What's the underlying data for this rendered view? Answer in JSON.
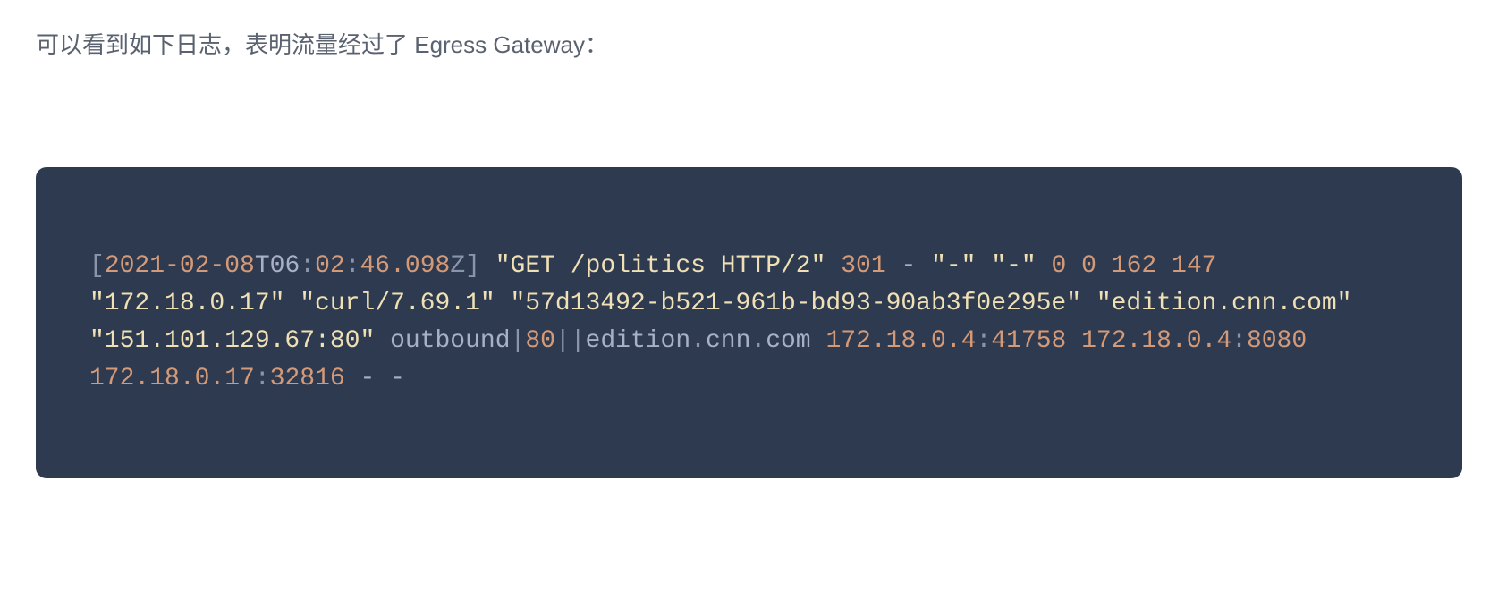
{
  "intro": "可以看到如下日志，表明流量经过了 Egress Gateway：",
  "log": {
    "open_bracket": "[",
    "date": "2021-02-08",
    "t": "T06",
    "c1": ":",
    "min": "02",
    "c2": ":",
    "sec": "46.098",
    "z_close": "Z] ",
    "req": "\"GET /politics HTTP/2\"",
    "sp1": " ",
    "status": "301",
    "dash_group": " - ",
    "q1": "\"-\"",
    "sp2": " ",
    "q2": "\"-\"",
    "sp3": " ",
    "n0a": "0",
    "sp4": " ",
    "n0b": "0",
    "sp5": " ",
    "n162": "162",
    "sp6": " ",
    "n147": "147",
    "sp7": " ",
    "ip1": "\"172.18.0.17\"",
    "sp8": " ",
    "agent": "\"curl/7.69.1\"",
    "sp9": " ",
    "uuid": "\"57d13492-b521-961b-bd93-90ab3f0e295e\"",
    "sp10": " ",
    "host": "\"edition.cnn.com\"",
    "sp11": " ",
    "target": "\"151.101.129.67:80\"",
    "sp12": " ",
    "outbound": "outbound",
    "pipe1": "|",
    "port80": "80",
    "pipe2": "||",
    "edition": "edition",
    "dot1": ".",
    "cnn": "cnn",
    "dot2": ".",
    "com": "com",
    "sp13": " ",
    "ip_a1": "172.18.0.4",
    "colon_a": ":",
    "port_a": "41758",
    "sp14": " ",
    "ip_b1": "172.18.0.4",
    "colon_b": ":",
    "port_b": "8080",
    "sp15": " ",
    "ip_c1": "172.18.0.17",
    "colon_c": ":",
    "port_c": "32816",
    "trail": " - -"
  }
}
